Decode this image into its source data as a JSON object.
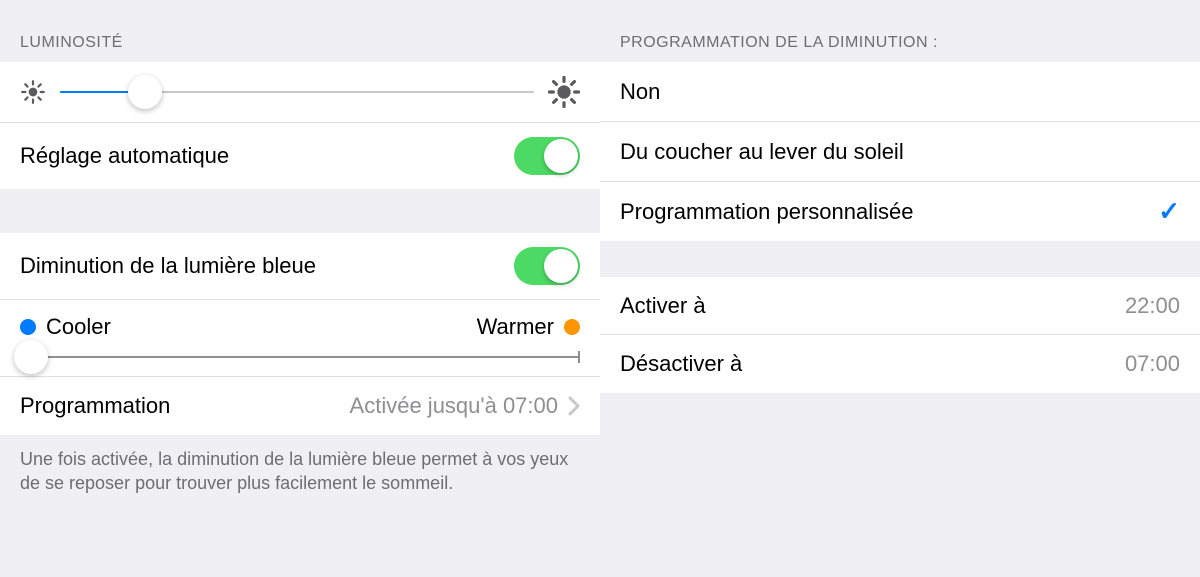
{
  "left": {
    "header": "Luminosité",
    "brightness": {
      "percent": 18
    },
    "auto_label": "Réglage automatique",
    "auto_on": true,
    "bluelight_label": "Diminution de la lumière bleue",
    "bluelight_on": true,
    "temp": {
      "cooler": "Cooler",
      "warmer": "Warmer",
      "percent": 2
    },
    "schedule_label": "Programmation",
    "schedule_value": "Activée jusqu'à 07:00",
    "footnote": "Une fois activée, la diminution de la lumière bleue permet à vos yeux de se reposer pour trouver plus facilement le sommeil."
  },
  "right": {
    "header": "Programmation de la diminution :",
    "options": [
      {
        "label": "Non",
        "selected": false
      },
      {
        "label": "Du coucher au lever du soleil",
        "selected": false
      },
      {
        "label": "Programmation personnalisée",
        "selected": true
      }
    ],
    "enable_label": "Activer à",
    "enable_value": "22:00",
    "disable_label": "Désactiver à",
    "disable_value": "07:00"
  },
  "colors": {
    "accent": "#007aff",
    "toggle_on": "#4cd964",
    "orange": "#ff9500"
  }
}
